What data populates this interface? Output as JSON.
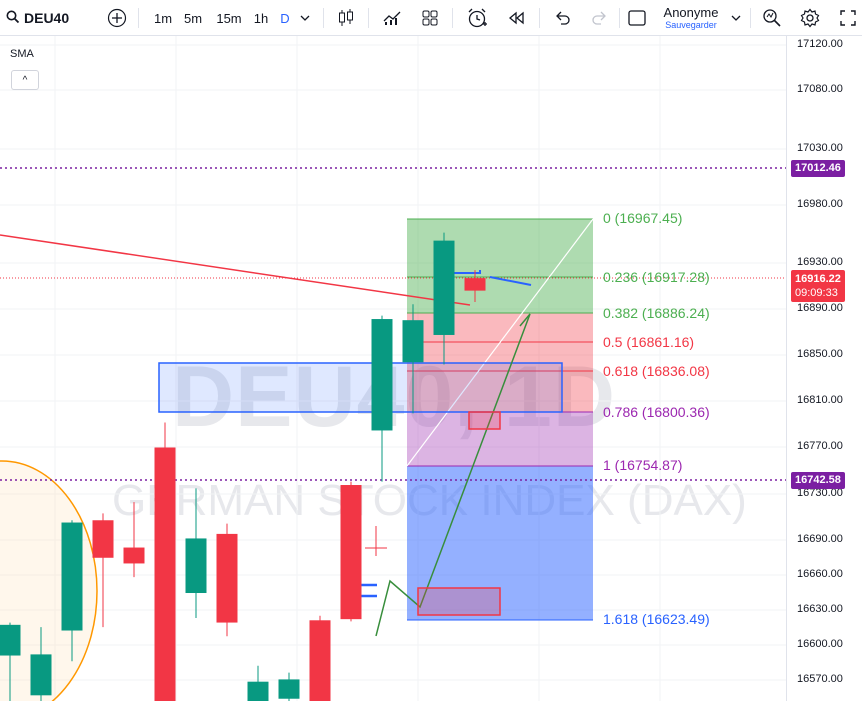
{
  "toolbar": {
    "symbol": "DEU40",
    "intervals": [
      "1m",
      "5m",
      "15m",
      "1h",
      "D"
    ],
    "active_interval": "D",
    "user_name": "Anonyme",
    "save_label": "Sauvegarder",
    "icons": [
      "search-icon",
      "add-symbol-icon",
      "interval-chevron-icon",
      "candles-icon",
      "indicators-icon",
      "layouts-icon",
      "alert-icon",
      "replay-icon",
      "undo-icon",
      "redo-icon",
      "fullscreen-square-icon",
      "account-chevron-icon",
      "quick-search-icon",
      "settings-icon",
      "fullscreen-icon"
    ]
  },
  "legend": {
    "indicator": "SMA",
    "collapse_glyph": "^"
  },
  "watermark": {
    "symbol_text": "DEU40, 1D",
    "description": "GERMAN STOCK INDEX (DAX)"
  },
  "price_scale": {
    "ticks": [
      "17120.00",
      "17080.00",
      "17030.00",
      "16980.00",
      "16930.00",
      "16890.00",
      "16850.00",
      "16810.00",
      "16770.00",
      "16730.00",
      "16690.00",
      "16660.00",
      "16630.00",
      "16600.00",
      "16570.00"
    ],
    "labels": [
      {
        "text": "17012.46",
        "color": "#7b1fa2"
      },
      {
        "text": "16916.22",
        "sub": "09:09:33",
        "color": "#f23645"
      },
      {
        "text": "16742.58",
        "color": "#7b1fa2"
      }
    ]
  },
  "fibonacci": {
    "levels": [
      {
        "text": "0 (16967.45)",
        "color": "#4caf50"
      },
      {
        "text": "0.236 (16917.28)",
        "color": "#4caf50"
      },
      {
        "text": "0.382 (16886.24)",
        "color": "#4caf50"
      },
      {
        "text": "0.5 (16861.16)",
        "color": "#f23645"
      },
      {
        "text": "0.618 (16836.08)",
        "color": "#f23645"
      },
      {
        "text": "0.786 (16800.36)",
        "color": "#9c27b0"
      },
      {
        "text": "1 (16754.87)",
        "color": "#9c27b0"
      },
      {
        "text": "1.618 (16623.49)",
        "color": "#2962ff"
      }
    ]
  },
  "colors": {
    "up": "#089981",
    "down": "#f23645",
    "accent": "#2962ff",
    "purple": "#7b1fa2"
  },
  "chart_data": {
    "type": "candlestick",
    "symbol": "DEU40",
    "interval": "1D",
    "ylim": [
      16555,
      17140
    ],
    "candles": [
      {
        "o": 16595,
        "h": 16624,
        "l": 16550,
        "c": 16622
      },
      {
        "o": 16560,
        "h": 16620,
        "l": 16550,
        "c": 16596
      },
      {
        "o": 16617,
        "h": 16714,
        "l": 16590,
        "c": 16712
      },
      {
        "o": 16714,
        "h": 16720,
        "l": 16620,
        "c": 16681
      },
      {
        "o": 16690,
        "h": 16730,
        "l": 16664,
        "c": 16676
      },
      {
        "o": 16778,
        "h": 16800,
        "l": 16545,
        "c": 16545
      },
      {
        "o": 16650,
        "h": 16742,
        "l": 16628,
        "c": 16698
      },
      {
        "o": 16702,
        "h": 16711,
        "l": 16612,
        "c": 16624
      },
      {
        "o": 16550,
        "h": 16586,
        "l": 16540,
        "c": 16572
      },
      {
        "o": 16557,
        "h": 16580,
        "l": 16540,
        "c": 16574
      },
      {
        "o": 16626,
        "h": 16630,
        "l": 16548,
        "c": 16552
      },
      {
        "o": 16745,
        "h": 16748,
        "l": 16625,
        "c": 16627
      },
      {
        "o": 16793,
        "h": 16894,
        "l": 16748,
        "c": 16891
      },
      {
        "o": 16853,
        "h": 16904,
        "l": 16808,
        "c": 16890
      },
      {
        "o": 16877,
        "h": 16967,
        "l": 16851,
        "c": 16960
      },
      {
        "o": 16927,
        "h": 16934,
        "l": 16906,
        "c": 16916
      }
    ]
  }
}
